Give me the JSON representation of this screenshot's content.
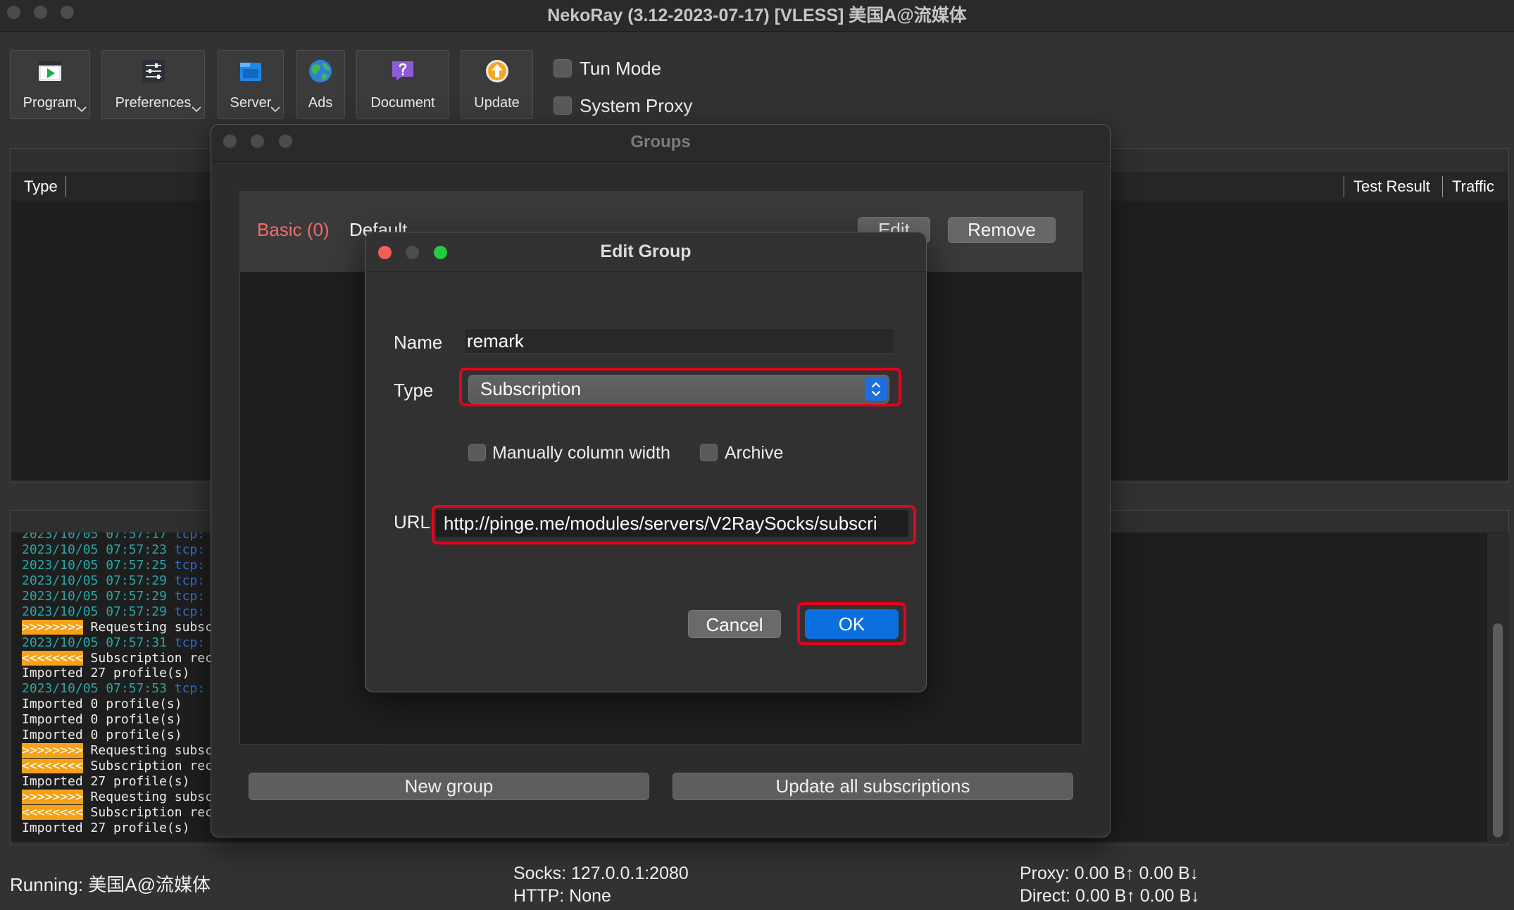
{
  "window": {
    "title": "NekoRay (3.12-2023-07-17) [VLESS] 美国A@流媒体"
  },
  "toolbar": {
    "program": {
      "label": "Program",
      "icon": "play-window-icon"
    },
    "preferences": {
      "label": "Preferences",
      "icon": "sliders-icon"
    },
    "server": {
      "label": "Server",
      "icon": "server-box-icon"
    },
    "ads": {
      "label": "Ads",
      "icon": "globe-icon"
    },
    "document": {
      "label": "Document",
      "icon": "help-bubble-icon"
    },
    "update": {
      "label": "Update",
      "icon": "update-arrow-icon"
    },
    "tun_mode": {
      "label": "Tun Mode",
      "checked": false
    },
    "system_proxy": {
      "label": "System Proxy",
      "checked": false
    }
  },
  "table": {
    "headers": {
      "type": "Type",
      "test_result": "Test Result",
      "traffic": "Traffic"
    }
  },
  "log": {
    "lines": [
      {
        "time": "2023/10/05 07:57:17",
        "proto": "tcp:"
      },
      {
        "time": "2023/10/05 07:57:23",
        "proto": "tcp:"
      },
      {
        "time": "2023/10/05 07:57:25",
        "proto": "tcp:"
      },
      {
        "time": "2023/10/05 07:57:29",
        "proto": "tcp:"
      },
      {
        "time": "2023/10/05 07:57:29",
        "proto": "tcp:"
      },
      {
        "time": "2023/10/05 07:57:29",
        "proto": "tcp:"
      },
      {
        "tag": ">>>>>>>>",
        "text": "Requesting subsc"
      },
      {
        "time": "2023/10/05 07:57:31",
        "proto": "tcp:"
      },
      {
        "tag": "<<<<<<<<",
        "text": "Subscription rec"
      },
      {
        "text": "Imported 27 profile(s)"
      },
      {
        "time": "2023/10/05 07:57:53",
        "proto": "tcp:"
      },
      {
        "text": "Imported 0 profile(s)"
      },
      {
        "text": "Imported 0 profile(s)"
      },
      {
        "text": "Imported 0 profile(s)"
      },
      {
        "tag": ">>>>>>>>",
        "text": "Requesting subsc"
      },
      {
        "tag": "<<<<<<<<",
        "text": "Subscription rec"
      },
      {
        "text": "Imported 27 profile(s)"
      },
      {
        "tag": ">>>>>>>>",
        "text": "Requesting subsc"
      },
      {
        "tag": "<<<<<<<<",
        "text": "Subscription rec"
      },
      {
        "text": "Imported 27 profile(s)"
      }
    ]
  },
  "status": {
    "running": "Running: 美国A@流媒体",
    "socks": "Socks: 127.0.0.1:2080",
    "http": "HTTP: None",
    "proxy": "Proxy: 0.00 B↑ 0.00 B↓",
    "direct": "Direct: 0.00 B↑ 0.00 B↓"
  },
  "groups": {
    "title": "Groups",
    "group": {
      "tag": "Basic (0)",
      "name": "Default",
      "edit": "Edit",
      "remove": "Remove"
    },
    "new_group": "New group",
    "update_all": "Update all subscriptions"
  },
  "edit_group": {
    "title": "Edit Group",
    "name_label": "Name",
    "name_value": "remark",
    "type_label": "Type",
    "type_value": "Subscription",
    "manual_col": {
      "label": "Manually column width",
      "checked": false
    },
    "archive": {
      "label": "Archive",
      "checked": false
    },
    "url_label": "URL",
    "url_value": "http://pinge.me/modules/servers/V2RaySocks/subscri",
    "cancel": "Cancel",
    "ok": "OK"
  },
  "colors": {
    "accent_blue": "#0b6fe0",
    "highlight_red": "#e8001c",
    "group_tag": "#f26b6b",
    "log_time": "#2aa7a7",
    "log_proto": "#2e6fd8",
    "log_tag_bg": "#f5a21a",
    "close_red": "#f25f58",
    "zoom_green": "#27c93f"
  }
}
